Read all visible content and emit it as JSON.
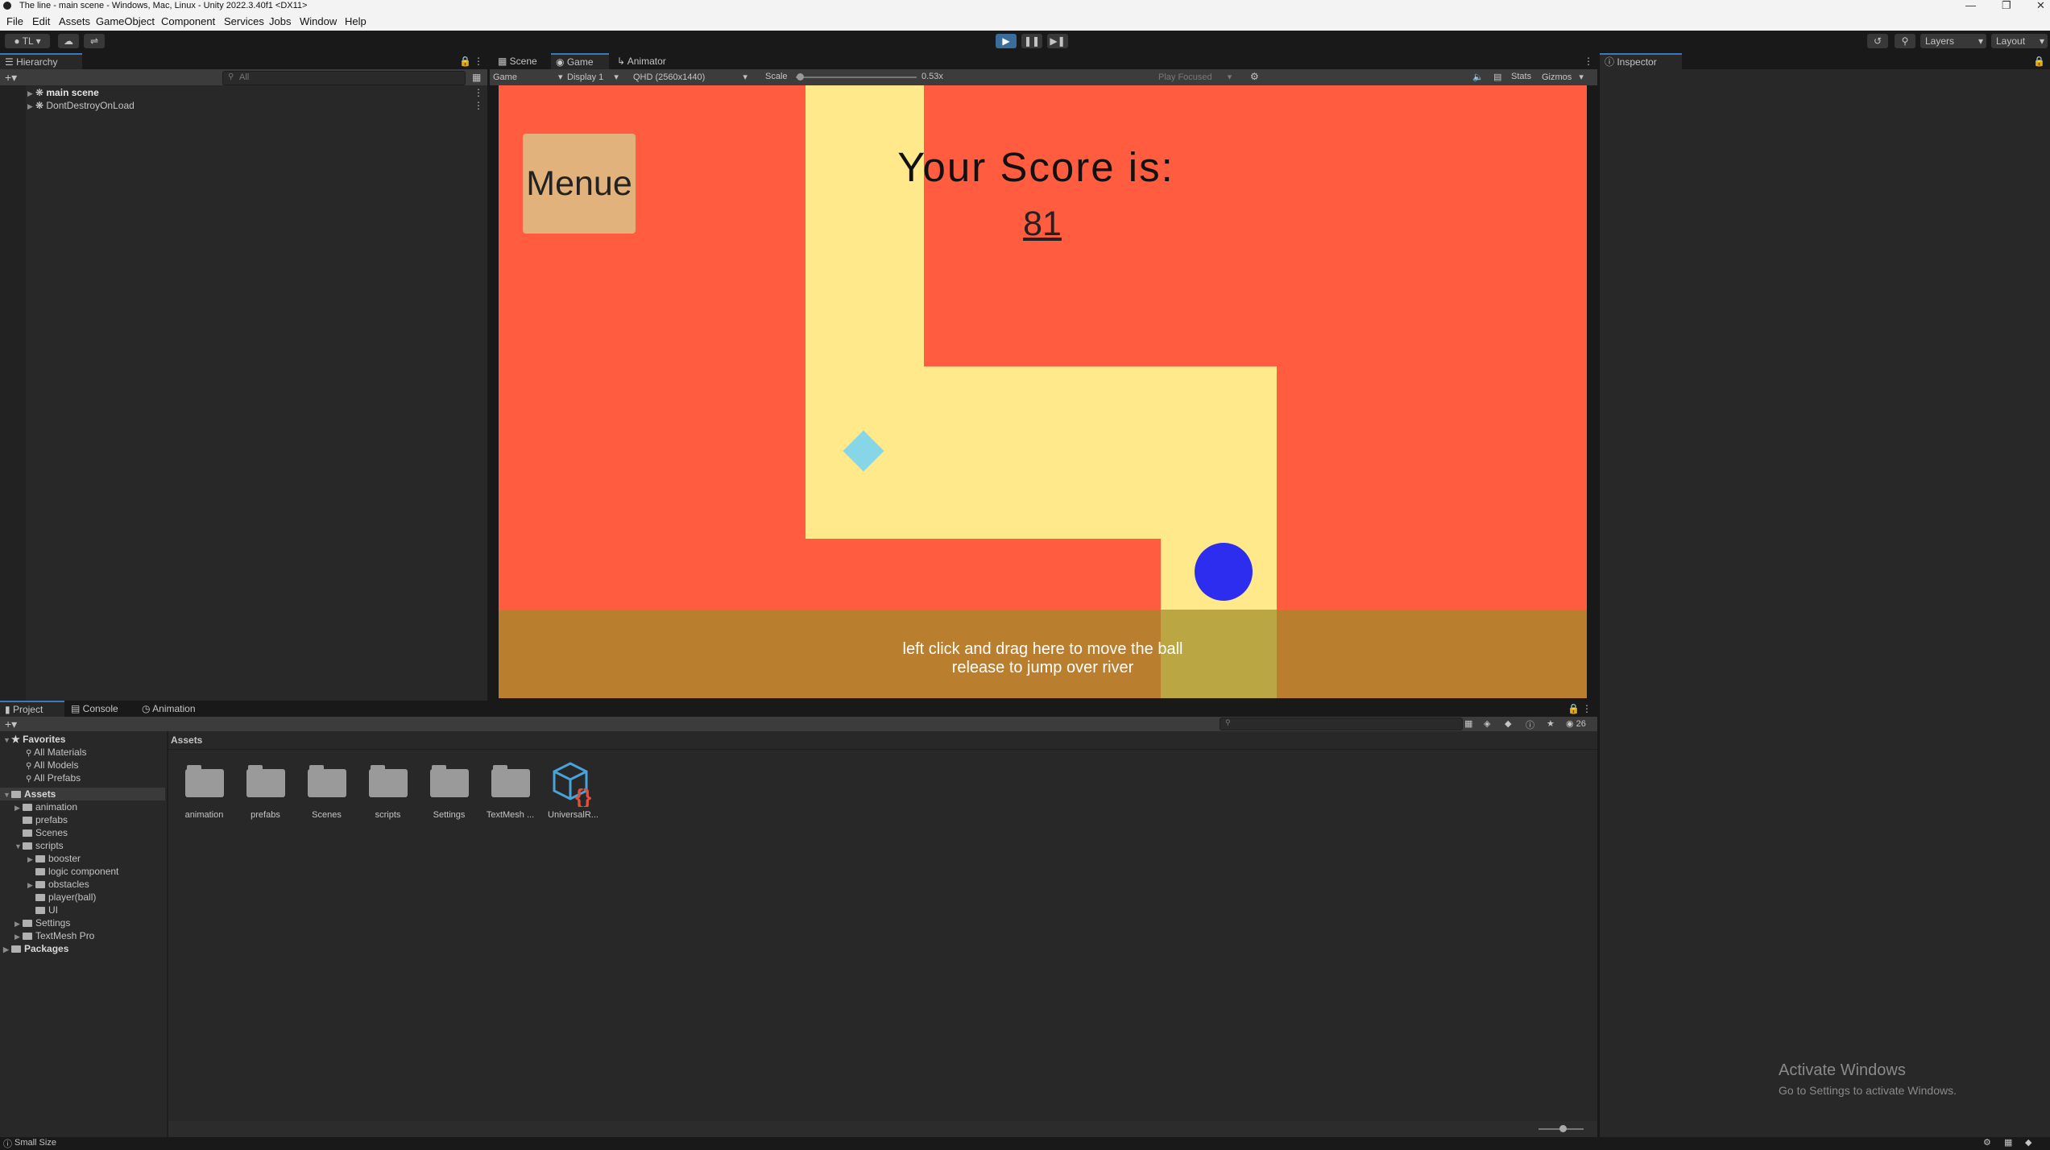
{
  "window_title": "The line - main scene - Windows, Mac, Linux - Unity 2022.3.40f1 <DX11>",
  "menu": [
    "File",
    "Edit",
    "Assets",
    "GameObject",
    "Component",
    "Services",
    "Jobs",
    "Window",
    "Help"
  ],
  "toolbar": {
    "account": "TL",
    "layers": "Layers",
    "layout": "Layout"
  },
  "hierarchy": {
    "tab": "Hierarchy",
    "search_placeholder": "All",
    "items": [
      "main scene",
      "DontDestroyOnLoad"
    ]
  },
  "center_tabs": [
    "Scene",
    "Game",
    "Animator"
  ],
  "game_bar": {
    "mode": "Game",
    "display": "Display 1",
    "resolution": "QHD (2560x1440)",
    "scale_label": "Scale",
    "scale_value": "0.53x",
    "play_focused": "Play Focused",
    "stats": "Stats",
    "gizmos": "Gizmos"
  },
  "game": {
    "menu_button": "Menue",
    "score_title": "Your Score is:",
    "score_value": "81",
    "hint_line1": "left click and drag here to move the ball",
    "hint_line2": "release to jump over river",
    "colors": {
      "background": "#ff5c40",
      "path": "#ffe98a",
      "ball": "#2d2df0",
      "diamond": "#86d6e8",
      "control_zone": "#b37f35",
      "button": "#e2b27c"
    }
  },
  "inspector": {
    "tab": "Inspector"
  },
  "bottom_tabs": [
    "Project",
    "Console",
    "Animation"
  ],
  "project": {
    "favorites_title": "Favorites",
    "favorites": [
      "All Materials",
      "All Models",
      "All Prefabs"
    ],
    "assets_title": "Assets",
    "tree": [
      {
        "label": "animation",
        "depth": 1
      },
      {
        "label": "prefabs",
        "depth": 1
      },
      {
        "label": "Scenes",
        "depth": 1
      },
      {
        "label": "scripts",
        "depth": 1
      },
      {
        "label": "booster",
        "depth": 2
      },
      {
        "label": "logic component",
        "depth": 2
      },
      {
        "label": "obstacles",
        "depth": 2
      },
      {
        "label": "player(ball)",
        "depth": 2
      },
      {
        "label": "UI",
        "depth": 2
      },
      {
        "label": "Settings",
        "depth": 1
      },
      {
        "label": "TextMesh Pro",
        "depth": 1
      }
    ],
    "packages_title": "Packages",
    "breadcrumb": "Assets",
    "grid_items": [
      "animation",
      "prefabs",
      "Scenes",
      "scripts",
      "Settings",
      "TextMesh ...",
      "UniversalR..."
    ],
    "count": "26"
  },
  "status": {
    "text": "Small Size"
  },
  "watermark": {
    "line1": "Activate Windows",
    "line2": "Go to Settings to activate Windows."
  }
}
